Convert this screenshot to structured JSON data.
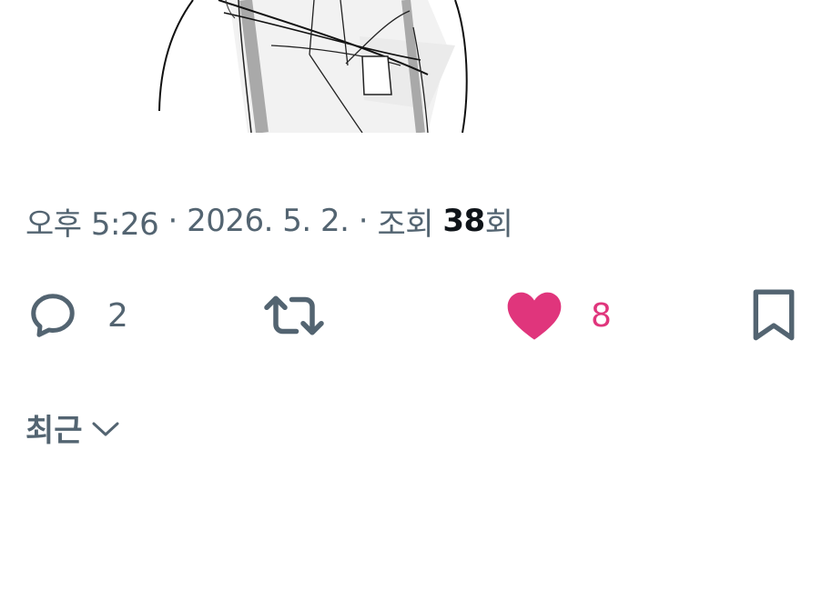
{
  "tweet": {
    "meta": {
      "time": "오후 5:26",
      "sep1": " · ",
      "date": "2026. 5. 2.",
      "sep2": " · ",
      "views_prefix": "조회 ",
      "views_count": "38",
      "views_suffix": "회"
    },
    "actions": {
      "reply": {
        "icon": "reply-icon",
        "count": "2"
      },
      "retweet": {
        "icon": "retweet-icon",
        "count": ""
      },
      "like": {
        "icon": "heart-icon",
        "count": "8",
        "active": true,
        "color": "#e0357c"
      },
      "bookmark": {
        "icon": "bookmark-icon"
      }
    }
  },
  "replies": {
    "sort_label": "최근",
    "sort_icon": "chevron-down-icon"
  },
  "colors": {
    "secondary_text": "#536471",
    "primary_text": "#0f1419",
    "like": "#e0357c",
    "background": "#ffffff"
  }
}
